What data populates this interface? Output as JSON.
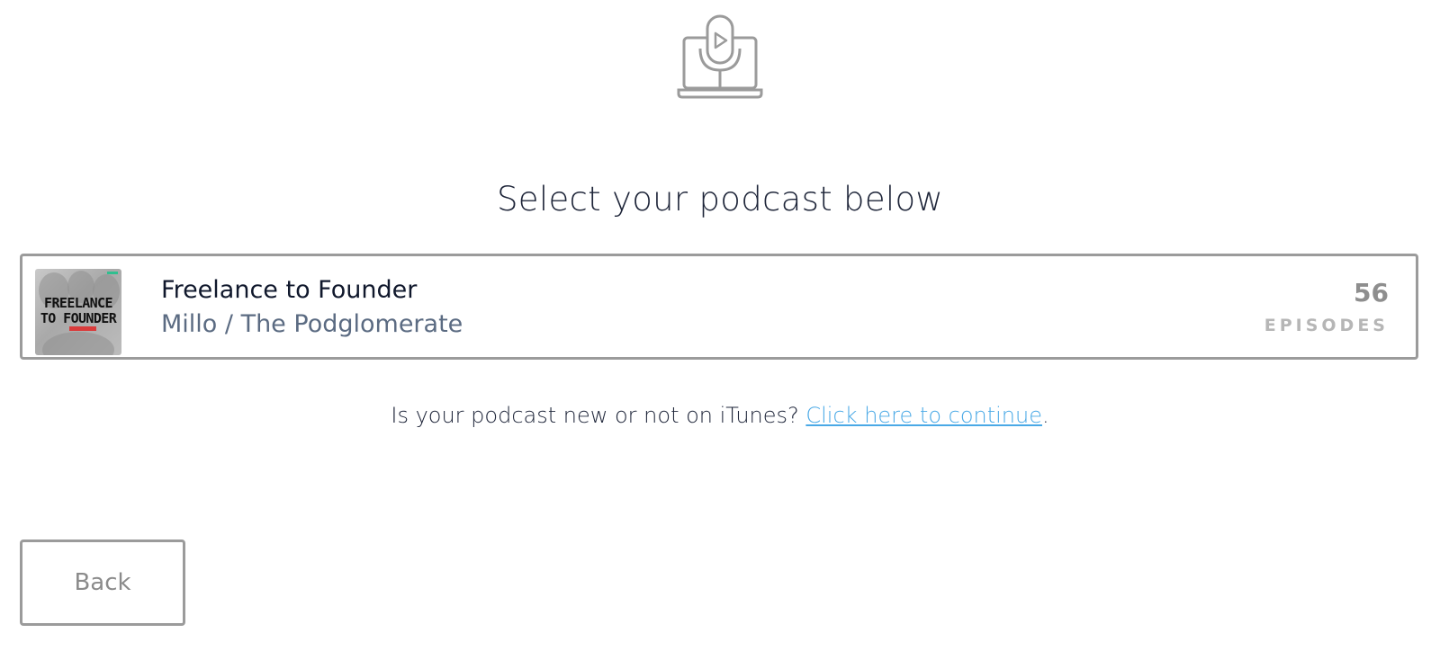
{
  "header": {
    "icon": "podcast-microphone-laptop-icon",
    "title": "Select your podcast below"
  },
  "podcast": {
    "name": "Freelance to Founder",
    "author": "Millo / The Podglomerate",
    "episode_count": "56",
    "episode_label": "EPISODES",
    "cover": {
      "line1": "FREELANCE",
      "line2": "TO FOUNDER"
    }
  },
  "hint": {
    "question": "Is your podcast new or not on iTunes? ",
    "link": "Click here to continue",
    "suffix": "."
  },
  "footer": {
    "back_label": "Back"
  },
  "colors": {
    "text_dark": "#1d2438",
    "link": "#4aa9e6",
    "border": "#9b9b9b"
  }
}
